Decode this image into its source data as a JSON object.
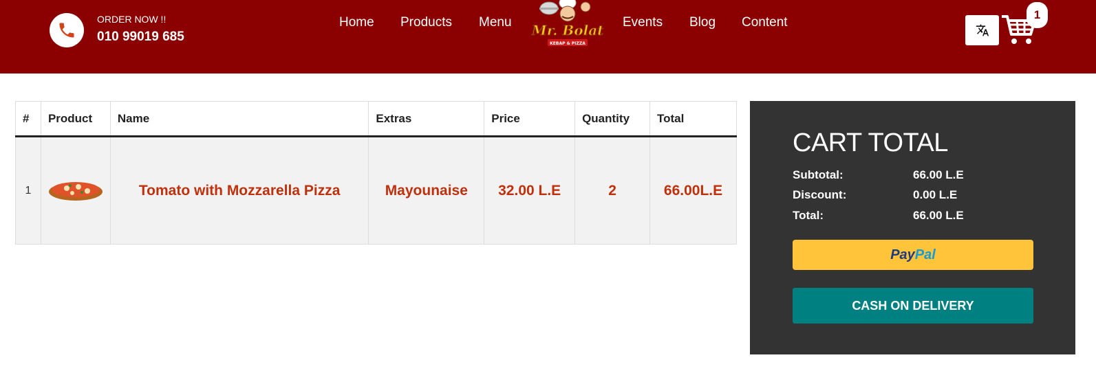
{
  "header": {
    "order_label": "ORDER NOW !!",
    "phone": "010 99019 685",
    "nav": [
      "Home",
      "Products",
      "Menu",
      "Events",
      "Blog",
      "Content"
    ],
    "logo_text": "Mr. Bolat",
    "logo_subtext": "KEBAP & PIZZA",
    "cart_count": "1",
    "lang_icon": "translate-icon",
    "cart_icon": "shopping-cart-icon"
  },
  "table": {
    "headers": [
      "#",
      "Product",
      "Name",
      "Extras",
      "Price",
      "Quantity",
      "Total"
    ],
    "rows": [
      {
        "num": "1",
        "image": "pizza-image",
        "name": "Tomato with Mozzarella Pizza",
        "extras": "Mayounaise",
        "price": "32.00 L.E",
        "quantity": "2",
        "total": "66.00L.E"
      }
    ]
  },
  "cart_total": {
    "title": "CART TOTAL",
    "subtotal_label": "Subtotal:",
    "subtotal_value": "66.00 L.E",
    "discount_label": "Discount:",
    "discount_value": "0.00 L.E",
    "total_label": "Total:",
    "total_value": "66.00 L.E",
    "paypal_a": "Pay",
    "paypal_b": "Pal",
    "cod_label": "CASH ON DELIVERY"
  },
  "colors": {
    "header_bg": "#8b0000",
    "accent_text": "#c0300a",
    "panel_bg": "#333333",
    "paypal_yellow": "#ffc439",
    "cod_teal": "#008080"
  }
}
